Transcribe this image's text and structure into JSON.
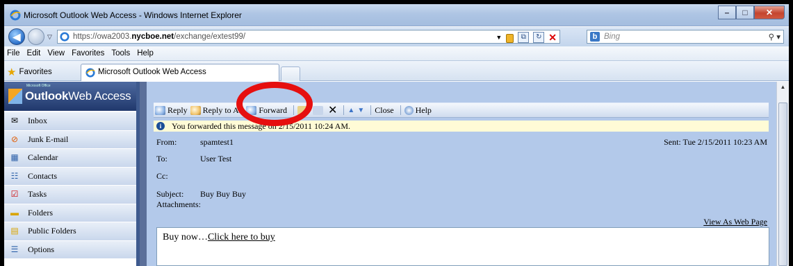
{
  "window": {
    "title": "Microsoft Outlook Web Access - Windows Internet Explorer"
  },
  "address": {
    "url_prefix": "https://owa2003.",
    "url_domain": "nycboe.net",
    "url_path": "/exchange/extest99/"
  },
  "search": {
    "placeholder": "Bing",
    "icons": [
      "bing-icon",
      "search-icon"
    ]
  },
  "menu": [
    "File",
    "Edit",
    "View",
    "Favorites",
    "Tools",
    "Help"
  ],
  "favorites": {
    "label": "Favorites"
  },
  "tab": {
    "label": "Microsoft Outlook Web Access"
  },
  "owa": {
    "brand_small": "Microsoft Office",
    "brand_bold": "Outlook",
    "brand_rest": "Web Access"
  },
  "nav": [
    {
      "label": "Inbox",
      "icon": "envelope-icon"
    },
    {
      "label": "Junk E-mail",
      "icon": "junk-icon"
    },
    {
      "label": "Calendar",
      "icon": "calendar-icon"
    },
    {
      "label": "Contacts",
      "icon": "contacts-icon"
    },
    {
      "label": "Tasks",
      "icon": "tasks-icon"
    },
    {
      "label": "Folders",
      "icon": "folder-icon"
    },
    {
      "label": "Public Folders",
      "icon": "public-folder-icon"
    },
    {
      "label": "Options",
      "icon": "options-icon"
    }
  ],
  "toolbar": {
    "reply": "Reply",
    "reply_all": "Reply to All",
    "forward": "Forward",
    "close": "Close",
    "help": "Help"
  },
  "message": {
    "info": "You forwarded this message on 2/15/2011 10:24 AM.",
    "from_label": "From:",
    "from": "spamtest1",
    "sent": "Sent: Tue 2/15/2011 10:23 AM",
    "to_label": "To:",
    "to": "User Test",
    "cc_label": "Cc:",
    "subject_label": "Subject:",
    "subject": "Buy Buy Buy",
    "attachments_label": "Attachments:",
    "view_web": "View As Web Page",
    "body_text": "Buy now…",
    "body_link": "Click here to buy"
  },
  "colors": {
    "annotation": "#e60f0f",
    "owa_header": "#20386c",
    "reading_pane": "#b3c9ea",
    "info_bar": "#fffbd6"
  }
}
